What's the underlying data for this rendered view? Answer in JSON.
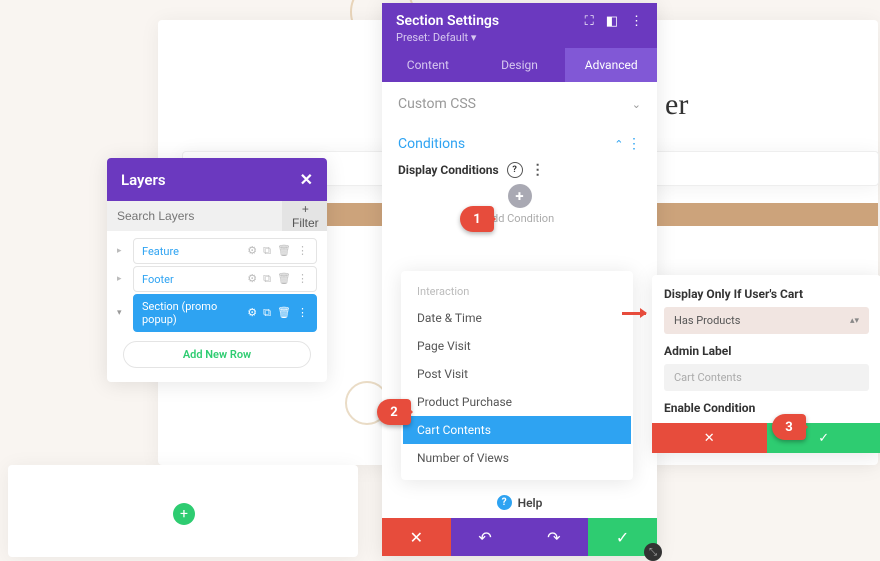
{
  "layers": {
    "title": "Layers",
    "search_placeholder": "Search Layers",
    "filter_label": "+ Filter",
    "items": [
      {
        "label": "Feature"
      },
      {
        "label": "Footer"
      },
      {
        "label": "Section (promo popup)"
      }
    ],
    "add_row": "Add New Row"
  },
  "settings": {
    "title": "Section Settings",
    "preset": "Preset: Default ▾",
    "tabs": [
      "Content",
      "Design",
      "Advanced"
    ],
    "section_css": "Custom CSS",
    "section_conditions": "Conditions",
    "dc_label": "Display Conditions",
    "add_condition": "Add Condition",
    "help": "Help"
  },
  "dropdown": {
    "category": "Interaction",
    "items": [
      "Date & Time",
      "Page Visit",
      "Post Visit",
      "Product Purchase",
      "Cart Contents",
      "Number of Views"
    ]
  },
  "cond": {
    "label1": "Display Only If User's Cart",
    "select_value": "Has Products",
    "label2": "Admin Label",
    "input_placeholder": "Cart Contents",
    "label3": "Enable Condition"
  },
  "steps": {
    "s1": "1",
    "s2": "2",
    "s3": "3"
  },
  "bg": {
    "title_frag": "er"
  }
}
